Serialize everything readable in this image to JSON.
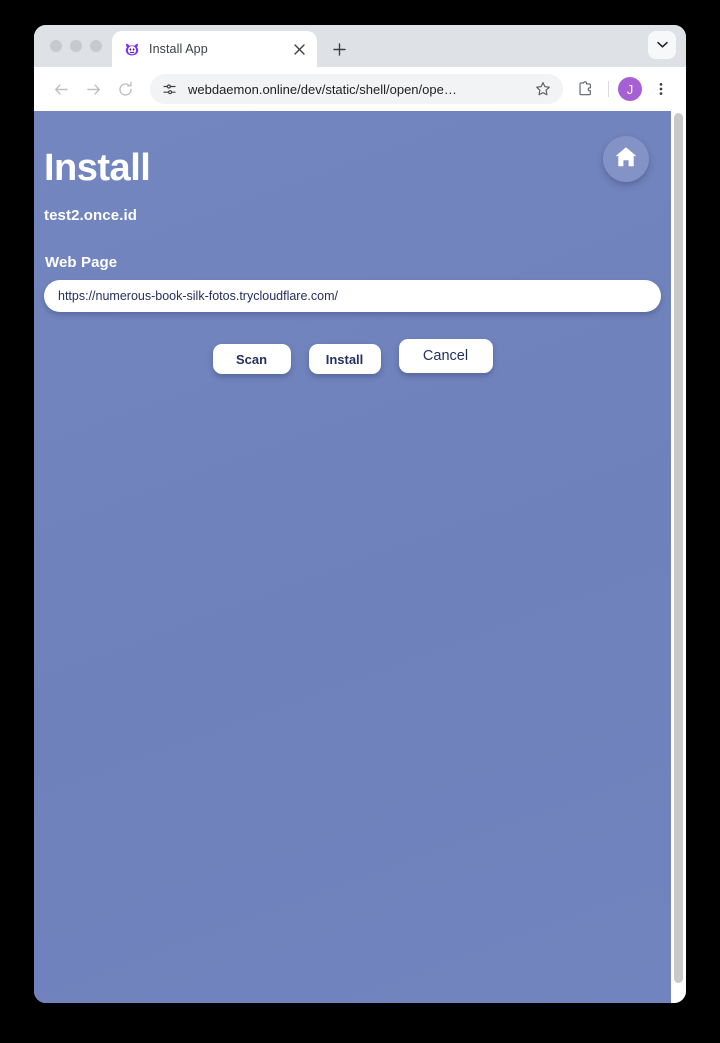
{
  "browser": {
    "traffic_lights": [
      "close",
      "minimize",
      "maximize"
    ],
    "tab": {
      "title": "Install App",
      "favicon_name": "devil-face-favicon",
      "close_label": "✕"
    },
    "new_tab_label": "+",
    "tab_list_label": "⌄",
    "toolbar": {
      "back_label": "←",
      "forward_label": "→",
      "reload_label": "↻",
      "url": "webdaemon.online/dev/static/shell/open/ope…",
      "site_settings_name": "tune-icon",
      "bookmark_label": "☆",
      "extensions_name": "puzzle-icon",
      "profile_initial": "J",
      "menu_label": "⋮"
    }
  },
  "page": {
    "title": "Install",
    "subtitle": "test2.once.id",
    "home_button_name": "home-icon",
    "form": {
      "web_page_label": "Web Page",
      "web_page_value": "https://numerous-book-silk-fotos.trycloudflare.com/",
      "web_page_placeholder": "https://"
    },
    "buttons": {
      "scan": "Scan",
      "install": "Install",
      "cancel": "Cancel"
    },
    "colors": {
      "background": "#7183bd",
      "text": "#ffffff",
      "button_text": "#24305e",
      "button_bg": "#ffffff",
      "profile_avatar": "#a760d4"
    }
  }
}
